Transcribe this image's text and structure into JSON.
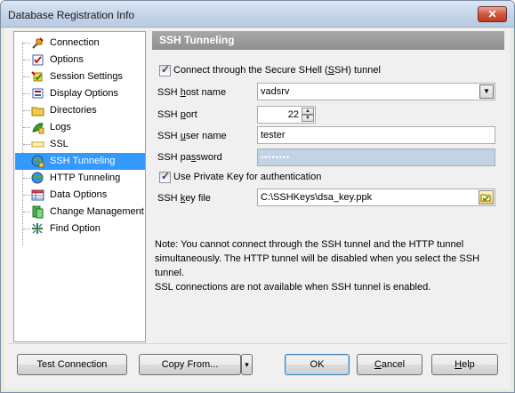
{
  "window": {
    "title": "Database Registration Info",
    "close_glyph": "✕"
  },
  "sidebar": {
    "items": [
      {
        "label": "Connection",
        "icon": "plug-icon"
      },
      {
        "label": "Options",
        "icon": "checklist-icon"
      },
      {
        "label": "Session Settings",
        "icon": "session-icon"
      },
      {
        "label": "Display Options",
        "icon": "display-icon"
      },
      {
        "label": "Directories",
        "icon": "folder-icon"
      },
      {
        "label": "Logs",
        "icon": "log-icon"
      },
      {
        "label": "SSL",
        "icon": "ssl-icon"
      },
      {
        "label": "SSH Tunneling",
        "icon": "ssh-globe-icon",
        "selected": true
      },
      {
        "label": "HTTP Tunneling",
        "icon": "http-globe-icon"
      },
      {
        "label": "Data Options",
        "icon": "table-icon"
      },
      {
        "label": "Change Management",
        "icon": "change-icon"
      },
      {
        "label": "Find Option",
        "icon": "find-icon"
      }
    ]
  },
  "panel": {
    "header": "SSH Tunneling",
    "connect_ssh": {
      "label_pre": "Connect through the Secure SHell (",
      "label_u": "S",
      "label_post": "SH) tunnel",
      "checked": true
    },
    "host": {
      "label_pre": "SSH ",
      "label_u": "h",
      "label_post": "ost name",
      "value": "vadsrv"
    },
    "port": {
      "label_pre": "SSH ",
      "label_u": "p",
      "label_post": "ort",
      "value": "22"
    },
    "user": {
      "label_pre": "SSH ",
      "label_u": "u",
      "label_post": "ser name",
      "value": "tester"
    },
    "password": {
      "label_pre": "SSH pa",
      "label_u": "s",
      "label_post": "sword",
      "value": "••••••••"
    },
    "private_key": {
      "label": "Use Private Key for authentication",
      "checked": true
    },
    "key_file": {
      "label_pre": "SSH ",
      "label_u": "k",
      "label_post": "ey file",
      "value": "C:\\SSHKeys\\dsa_key.ppk"
    },
    "note_1": "Note: You cannot connect through the SSH tunnel and the HTTP tunnel simultaneously. The HTTP tunnel will be disabled  when you select the SSH tunnel.",
    "note_2": "SSL connections are not available when SSH tunnel is enabled."
  },
  "buttons": {
    "test_connection": "Test Connection",
    "copy_from": "Copy From...",
    "copy_from_arrow": "▾",
    "ok": "OK",
    "cancel_u": "C",
    "cancel_rest": "ancel",
    "help_u": "H",
    "help_rest": "elp"
  },
  "colors": {
    "selection": "#3399ff",
    "header_bg": "#999999",
    "disabled_field": "#c3d3e6"
  }
}
